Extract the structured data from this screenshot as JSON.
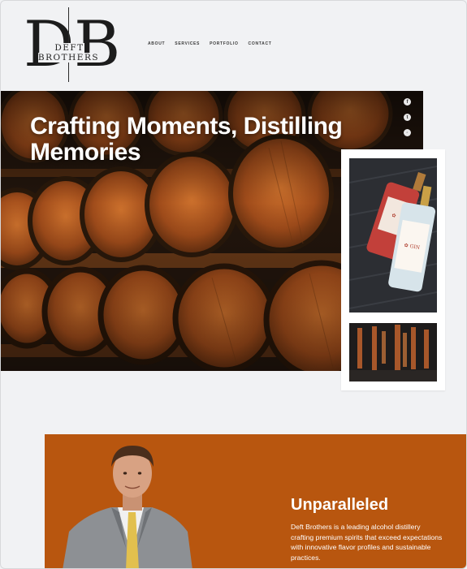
{
  "brand": {
    "logo_letters": [
      "D",
      "B"
    ],
    "logo_wordmark": "DEFT BROTHERS"
  },
  "nav": {
    "items": [
      "ABOUT",
      "SERVICES",
      "PORTFOLIO",
      "CONTACT"
    ]
  },
  "hero": {
    "title": "Crafting Moments, Distilling Memories",
    "social_icons": [
      "facebook-icon",
      "twitter-icon",
      "instagram-icon"
    ]
  },
  "feature": {
    "title": "Unparalleled",
    "description": "Deft Brothers is a leading alcohol distillery crafting premium spirits that exceed expectations with innovative flavor profiles and sustainable practices."
  },
  "colors": {
    "page_bg": "#f1f2f4",
    "accent_orange": "#b8560f",
    "hero_dark": "#1a110b"
  }
}
